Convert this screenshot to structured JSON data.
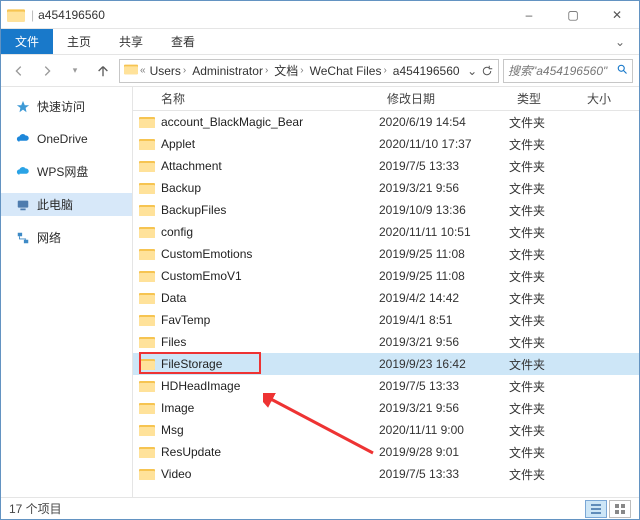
{
  "window": {
    "title": "a454196560",
    "min": "–",
    "max": "▢",
    "close": "✕"
  },
  "ribbon": {
    "file": "文件",
    "home": "主页",
    "share": "共享",
    "view": "查看"
  },
  "breadcrumb": [
    "Users",
    "Administrator",
    "文档",
    "WeChat Files",
    "a454196560"
  ],
  "search": {
    "placeholder": "搜索\"a454196560\""
  },
  "nav": {
    "quick": "快速访问",
    "onedrive": "OneDrive",
    "wps": "WPS网盘",
    "thispc": "此电脑",
    "network": "网络"
  },
  "columns": {
    "name": "名称",
    "date": "修改日期",
    "type": "类型",
    "size": "大小"
  },
  "type_folder": "文件夹",
  "files": [
    {
      "name": "account_BlackMagic_Bear",
      "date": "2020/6/19 14:54"
    },
    {
      "name": "Applet",
      "date": "2020/11/10 17:37"
    },
    {
      "name": "Attachment",
      "date": "2019/7/5 13:33"
    },
    {
      "name": "Backup",
      "date": "2019/3/21 9:56"
    },
    {
      "name": "BackupFiles",
      "date": "2019/10/9 13:36"
    },
    {
      "name": "config",
      "date": "2020/11/11 10:51"
    },
    {
      "name": "CustomEmotions",
      "date": "2019/9/25 11:08"
    },
    {
      "name": "CustomEmoV1",
      "date": "2019/9/25 11:08"
    },
    {
      "name": "Data",
      "date": "2019/4/2 14:42"
    },
    {
      "name": "FavTemp",
      "date": "2019/4/1 8:51"
    },
    {
      "name": "Files",
      "date": "2019/3/21 9:56"
    },
    {
      "name": "FileStorage",
      "date": "2019/9/23 16:42",
      "selected": true
    },
    {
      "name": "HDHeadImage",
      "date": "2019/7/5 13:33"
    },
    {
      "name": "Image",
      "date": "2019/3/21 9:56"
    },
    {
      "name": "Msg",
      "date": "2020/11/11 9:00"
    },
    {
      "name": "ResUpdate",
      "date": "2019/9/28 9:01"
    },
    {
      "name": "Video",
      "date": "2019/7/5 13:33"
    }
  ],
  "status": {
    "count": "17 个项目"
  }
}
